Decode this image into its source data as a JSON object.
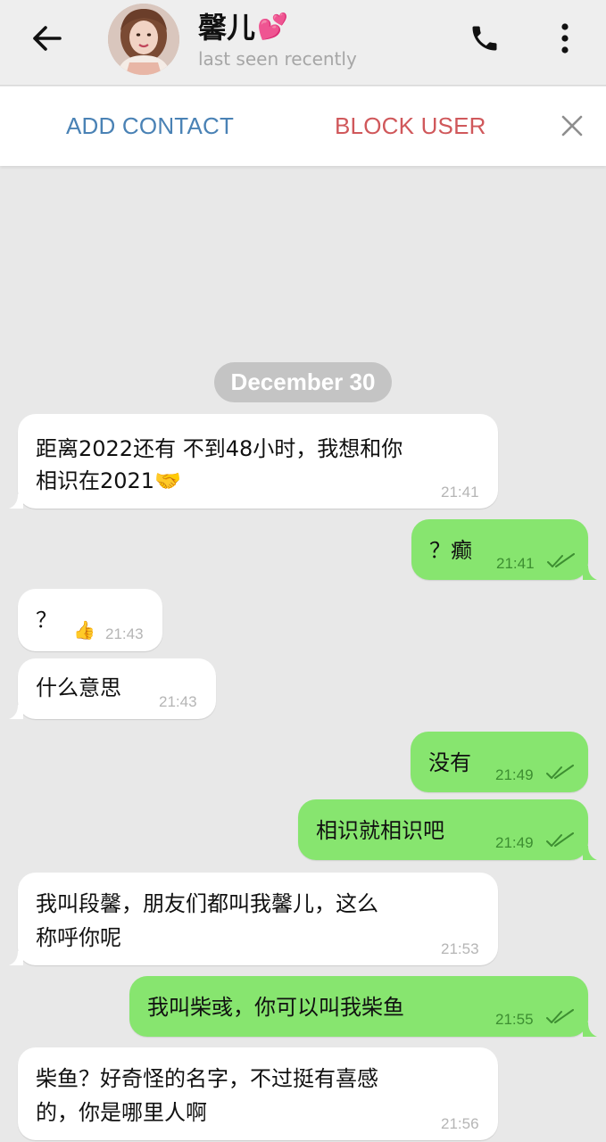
{
  "header": {
    "title": "馨儿",
    "title_emoji": "💕",
    "status": "last seen recently",
    "icons": [
      "back-arrow-icon",
      "phone-icon",
      "more-vertical-icon"
    ]
  },
  "actions": {
    "add_contact": "ADD CONTACT",
    "block_user": "BLOCK USER"
  },
  "date_separator": "December 30",
  "messages": [
    {
      "direction": "in",
      "line1": "距离2022还有 不到48小时，我想和你",
      "line2": "相识在2021",
      "emoji": "🤝",
      "time": "21:41"
    },
    {
      "direction": "out",
      "line1": "？癫",
      "time": "21:41",
      "read": true
    },
    {
      "direction": "in",
      "line1": "？",
      "reaction": "👍",
      "time": "21:43"
    },
    {
      "direction": "in",
      "line1": "什么意思",
      "time": "21:43"
    },
    {
      "direction": "out",
      "line1": "没有",
      "time": "21:49",
      "read": true
    },
    {
      "direction": "out",
      "line1": "相识就相识吧",
      "time": "21:49",
      "read": true
    },
    {
      "direction": "in",
      "line1": "我叫段馨，朋友们都叫我馨儿，这么",
      "line2": "称呼你呢",
      "time": "21:53"
    },
    {
      "direction": "out",
      "line1": "我叫柴彧，你可以叫我柴鱼",
      "time": "21:55",
      "read": true
    },
    {
      "direction": "in",
      "line1": "柴鱼？好奇怪的名字，不过挺有喜感",
      "line2": "的，你是哪里人啊",
      "time": "21:56"
    }
  ],
  "colors": {
    "header_bg": "#eeeeee",
    "chat_bg": "#e8e8e8",
    "incoming_bubble": "#ffffff",
    "outgoing_bubble": "#87e56f",
    "add_contact": "#4a82b5",
    "block_user": "#d0585b"
  }
}
